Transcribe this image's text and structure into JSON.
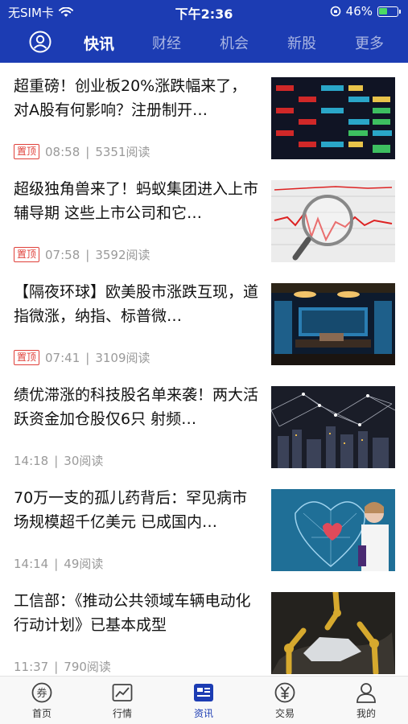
{
  "status_bar": {
    "carrier": "无SIM卡",
    "time": "下午2:36",
    "battery": "46%",
    "battery_level": 0.46
  },
  "top_tabs": [
    {
      "label": "快讯",
      "active": true
    },
    {
      "label": "财经",
      "active": false
    },
    {
      "label": "机会",
      "active": false
    },
    {
      "label": "新股",
      "active": false
    },
    {
      "label": "更多",
      "active": false
    }
  ],
  "news": [
    {
      "title": "超重磅！创业板20%涨跌幅来了，对A股有何影响？注册制开…",
      "tag": "置顶",
      "time": "08:58",
      "reads": "5351阅读",
      "image": "stock-ticker-board"
    },
    {
      "title": "超级独角兽来了！蚂蚁集团进入上市辅导期 这些上市公司和它…",
      "tag": "置顶",
      "time": "07:58",
      "reads": "3592阅读",
      "image": "magnifier-chart"
    },
    {
      "title": "【隔夜环球】欧美股市涨跌互现，道指微涨，纳指、标普微…",
      "tag": "置顶",
      "time": "07:41",
      "reads": "3109阅读",
      "image": "trading-room"
    },
    {
      "title": "绩优滞涨的科技股名单来袭！两大活跃资金加仓股仅6只 射频…",
      "tag": "",
      "time": "14:18",
      "reads": "30阅读",
      "image": "city-network"
    },
    {
      "title": "70万一支的孤儿药背后：罕见病市场规模超千亿美元 已成国内…",
      "tag": "",
      "time": "14:14",
      "reads": "49阅读",
      "image": "doctor-heart"
    },
    {
      "title": "工信部：《推动公共领域车辆电动化行动计划》已基本成型",
      "tag": "",
      "time": "11:37",
      "reads": "790阅读",
      "image": "robot-arms-factory"
    }
  ],
  "bottom_nav": [
    {
      "label": "首页",
      "icon": "coupon-icon",
      "active": false
    },
    {
      "label": "行情",
      "icon": "chart-icon",
      "active": false
    },
    {
      "label": "资讯",
      "icon": "news-icon",
      "active": true
    },
    {
      "label": "交易",
      "icon": "yen-icon",
      "active": false
    },
    {
      "label": "我的",
      "icon": "user-icon",
      "active": false
    }
  ],
  "colors": {
    "brand": "#1c3cb3",
    "tag": "#e0403a",
    "meta": "#9a9a9a"
  }
}
